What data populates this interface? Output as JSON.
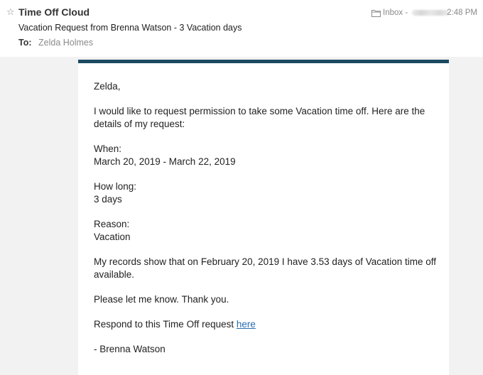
{
  "header": {
    "sender": "Time Off Cloud",
    "subject": "Vacation Request from Brenna Watson - 3 Vacation days",
    "to_label": "To:",
    "to_name": "Zelda Holmes",
    "mailbox": "Inbox -",
    "time": "2:48 PM",
    "star_icon": "star-outline",
    "folder_icon": "folder"
  },
  "message": {
    "greeting": "Zelda,",
    "intro": "I would like to request permission to take some Vacation time off. Here are the details of my request:",
    "when_label": "When:",
    "when_value": "March 20, 2019 - March 22, 2019",
    "howlong_label": "How long:",
    "howlong_value": "3 days",
    "reason_label": "Reason:",
    "reason_value": "Vacation",
    "records": "My records show that on February 20, 2019 I have 3.53 days of Vacation time off available.",
    "closing": "Please let me know. Thank you.",
    "respond_text": "Respond to this Time Off request",
    "respond_link": "here",
    "signature": "- Brenna Watson"
  },
  "colors": {
    "accent_bar": "#1b4a63",
    "link": "#2a6db0",
    "background": "#f2f2f2"
  }
}
